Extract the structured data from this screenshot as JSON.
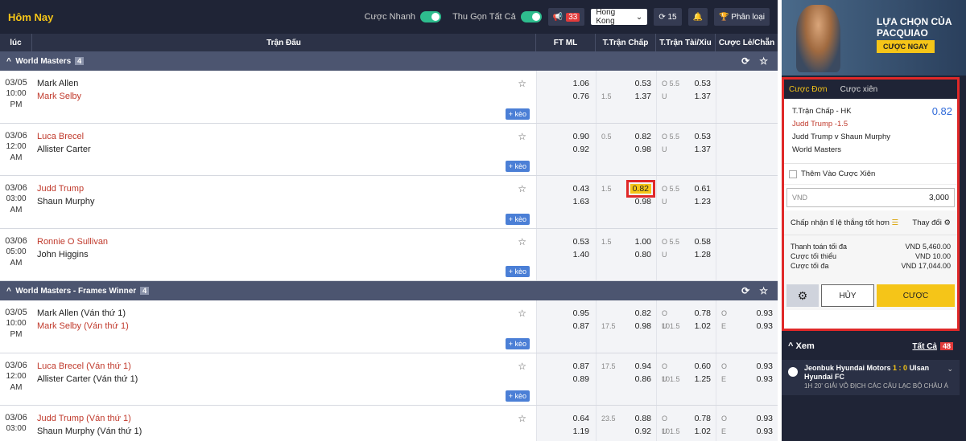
{
  "header": {
    "title": "Hôm Nay",
    "quick_bet": "Cược Nhanh",
    "collapse_all": "Thu Gọn Tất Cả",
    "notify_count": "33",
    "region": "Hong Kong",
    "refresh_count": "15",
    "sort": "Phân loại"
  },
  "columns": {
    "time": "lúc",
    "match": "Trận Đấu",
    "ft_ml": "FT ML",
    "handicap": "T.Trận Chấp",
    "over_under": "T.Trận Tài/Xỉu",
    "odd_even": "Cược Lẻ/Chẵn"
  },
  "more_label": "+ kèo",
  "league1": {
    "name": "World Masters",
    "count": "4",
    "rows": [
      {
        "date": "03/05",
        "time": "10:00",
        "ampm": "PM",
        "home": "Mark Allen",
        "away": "Mark Selby",
        "ml1": "1.06",
        "ml2": "0.76",
        "h1l": "",
        "h1": "0.53",
        "h2l": "1.5",
        "h2": "1.37",
        "o1l": "O 5.5",
        "o1": "0.53",
        "o2l": "U",
        "o2": "1.37"
      },
      {
        "date": "03/06",
        "time": "12:00",
        "ampm": "AM",
        "home": "Luca Brecel",
        "away": "Allister Carter",
        "ml1": "0.90",
        "ml2": "0.92",
        "h1l": "0.5",
        "h1": "0.82",
        "h2l": "",
        "h2": "0.98",
        "o1l": "O 5.5",
        "o1": "0.53",
        "o2l": "U",
        "o2": "1.37"
      },
      {
        "date": "03/06",
        "time": "03:00",
        "ampm": "AM",
        "home": "Judd Trump",
        "away": "Shaun Murphy",
        "ml1": "0.43",
        "ml2": "1.63",
        "h1l": "1.5",
        "h1": "0.82",
        "h2l": "",
        "h2": "0.98",
        "o1l": "O 5.5",
        "o1": "0.61",
        "o2l": "U",
        "o2": "1.23"
      },
      {
        "date": "03/06",
        "time": "05:00",
        "ampm": "AM",
        "home": "Ronnie O Sullivan",
        "away": "John Higgins",
        "ml1": "0.53",
        "ml2": "1.40",
        "h1l": "1.5",
        "h1": "1.00",
        "h2l": "",
        "h2": "0.80",
        "o1l": "O 5.5",
        "o1": "0.58",
        "o2l": "U",
        "o2": "1.28"
      }
    ]
  },
  "league2": {
    "name": "World Masters - Frames Winner",
    "count": "4",
    "rows": [
      {
        "date": "03/05",
        "time": "10:00",
        "ampm": "PM",
        "home": "Mark Allen (Ván thứ 1)",
        "away": "Mark Selby (Ván thứ 1)",
        "ml1": "0.95",
        "ml2": "0.87",
        "h1l": "",
        "h1": "0.82",
        "h2l": "17.5",
        "h2": "0.98",
        "o1l": "O 101.5",
        "o1": "0.78",
        "o2l": "U",
        "o2": "1.02",
        "e1l": "O",
        "e1": "0.93",
        "e2l": "E",
        "e2": "0.93"
      },
      {
        "date": "03/06",
        "time": "12:00",
        "ampm": "AM",
        "home": "Luca Brecel (Ván thứ 1)",
        "away": "Allister Carter (Ván thứ 1)",
        "ml1": "0.87",
        "ml2": "0.89",
        "h1l": "17.5",
        "h1": "0.94",
        "h2l": "",
        "h2": "0.86",
        "o1l": "O 101.5",
        "o1": "0.60",
        "o2l": "U",
        "o2": "1.25",
        "e1l": "O",
        "e1": "0.93",
        "e2l": "E",
        "e2": "0.93"
      },
      {
        "date": "03/06",
        "time": "03:00",
        "ampm": "",
        "home": "Judd Trump (Ván thứ 1)",
        "away": "Shaun Murphy (Ván thứ 1)",
        "ml1": "0.64",
        "ml2": "1.19",
        "h1l": "23.5",
        "h1": "0.88",
        "h2l": "",
        "h2": "0.92",
        "o1l": "O 101.5",
        "o1": "0.78",
        "o2l": "U",
        "o2": "1.02",
        "e1l": "O",
        "e1": "0.93",
        "e2l": "E",
        "e2": "0.93"
      }
    ]
  },
  "banner": {
    "line1": "LỰA CHỌN CỦA",
    "line2": "PACQUIAO",
    "cta": "CƯỢC NGAY"
  },
  "slip": {
    "tab_single": "Cược Đơn",
    "tab_parlay": "Cược xiên",
    "market": "T.Trận Chấp - HK",
    "odds": "0.82",
    "selection": "Judd Trump -1.5",
    "match": "Judd Trump v Shaun Murphy",
    "league": "World Masters",
    "add_parlay": "Thêm Vào Cược Xiên",
    "currency": "VND",
    "stake": "3,000",
    "accept_better": "Chấp nhận tỉ lệ thắng tốt hơn",
    "change": "Thay đổi",
    "max_payout_label": "Thanh toán tối đa",
    "max_payout": "VND 5,460.00",
    "min_bet_label": "Cược tối thiểu",
    "min_bet": "VND 10.00",
    "max_bet_label": "Cược tối đa",
    "max_bet": "VND 17,044.00",
    "cancel": "HỦY",
    "place": "CƯỢC"
  },
  "watch": {
    "title": "Xem",
    "all": "Tất Cả",
    "all_count": "48",
    "home": "Jeonbuk Hyundai Motors",
    "score": "1 : 0",
    "away": "Ulsan Hyundai FC",
    "info": "1H 20' GIẢI VÔ ĐỊCH CÁC CÂU LẠC BỘ CHÂU Á"
  }
}
